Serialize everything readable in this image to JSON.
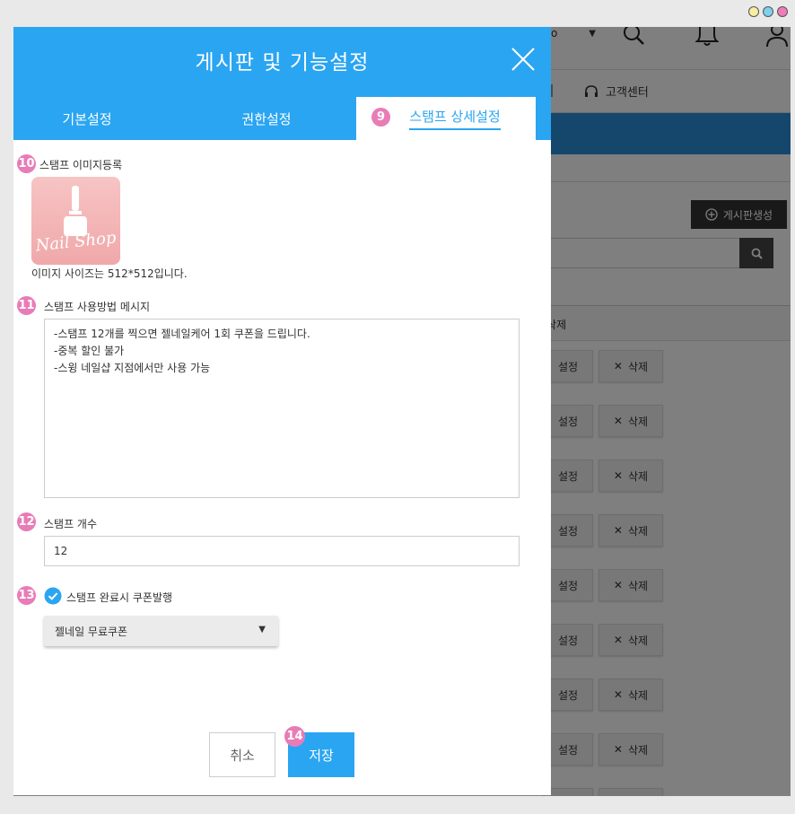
{
  "background": {
    "language_select": "o",
    "nav_item_label": "고객센터",
    "create_board_label": "게시판생성",
    "table_header_label": "/삭제",
    "row_set_label": "설정",
    "row_delete_label": "삭제"
  },
  "modal": {
    "title": "게시판 및 기능설정",
    "tabs": {
      "basic": "기본설정",
      "permission": "권한설정",
      "stamp": "스탬프 상세설정"
    },
    "badges": {
      "tab": "9",
      "image": "10",
      "message": "11",
      "count": "12",
      "coupon": "13",
      "save": "14"
    },
    "stamp_image": {
      "label": "스탬프 이미지등록",
      "logo_text": "Nail Shop",
      "hint": "이미지 사이즈는 512*512입니다."
    },
    "message": {
      "label": "스탬프 사용방법 메시지",
      "value": "-스탬프 12개를 찍으면 젤네일케어 1회 쿠폰을 드립니다.\n-중복 할인 불가\n-스윙 네일샵 지점에서만 사용 가능"
    },
    "count": {
      "label": "스탬프 개수",
      "value": "12"
    },
    "coupon": {
      "label": "스탬프 완료시 쿠폰발행",
      "checked": true,
      "selected": "젤네일 무료쿠폰"
    },
    "buttons": {
      "cancel": "취소",
      "save": "저장"
    }
  },
  "colors": {
    "primary": "#2aa5f2",
    "badge": "#e87cb7",
    "overlay": "rgba(0,0,0,0.5)"
  }
}
